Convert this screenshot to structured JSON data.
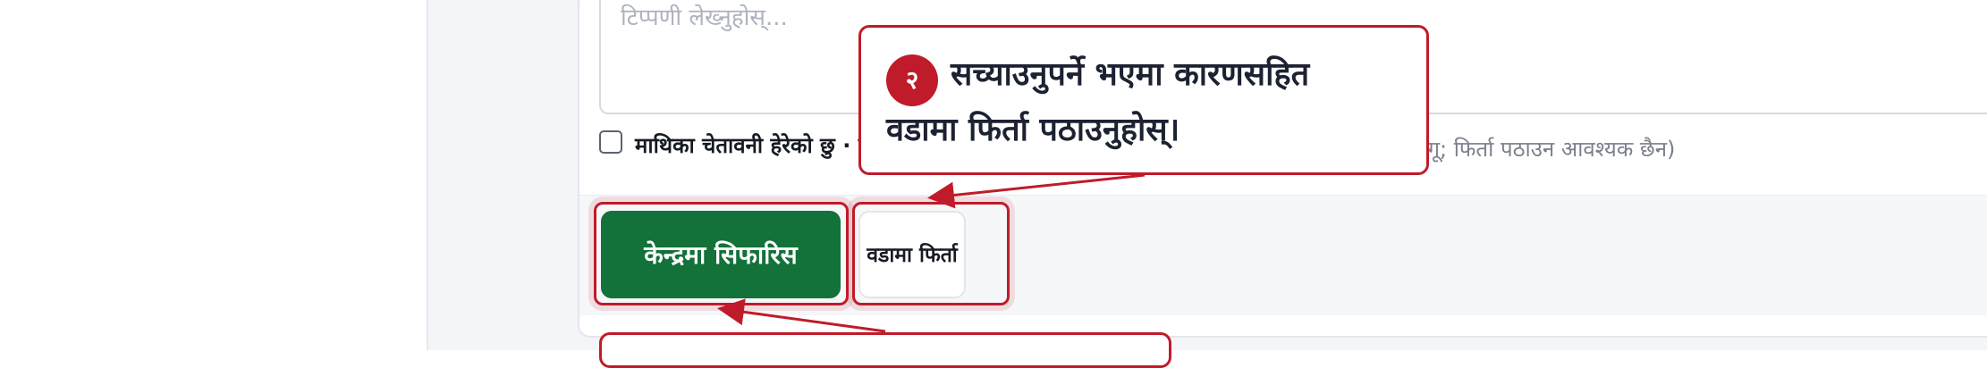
{
  "form": {
    "remarks_placeholder": "टिप्पणी लेख्नुहोस्...",
    "confirm_label": "माथिका चेतावनी हेरेको छु · ज",
    "confirm_note": "लागू; फिर्ता पठाउन आवश्यक छैन)"
  },
  "actions": {
    "recommend_label": "केन्द्रमा सिफारिस",
    "return_label": "वडामा फिर्ता"
  },
  "callout": {
    "number": "२",
    "line1": "सच्याउनुपर्ने भएमा कारणसहित",
    "line2": "वडामा फिर्ता पठाउनुहोस्।"
  },
  "colors": {
    "accent": "#c01b2a",
    "primary_button": "#127239"
  }
}
